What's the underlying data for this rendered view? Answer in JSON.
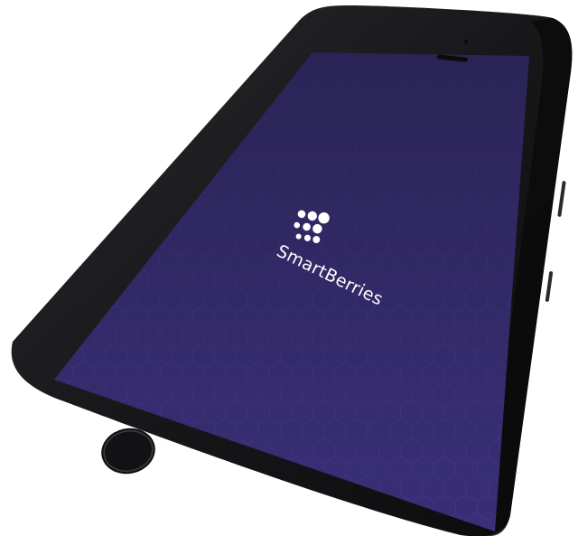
{
  "app": {
    "brand_name": "SmartBerries",
    "logo_icon": "berry-dots-icon"
  },
  "device": {
    "type": "smartphone",
    "body_color": "#1c1c1e",
    "screen_color": "#2f2760",
    "screen_color_dark": "#251f4d",
    "pattern": "hexagon-pattern",
    "home_button_icon": "home-button-icon",
    "speaker_icon": "earpiece-speaker-icon",
    "camera_icon": "front-camera-icon"
  }
}
